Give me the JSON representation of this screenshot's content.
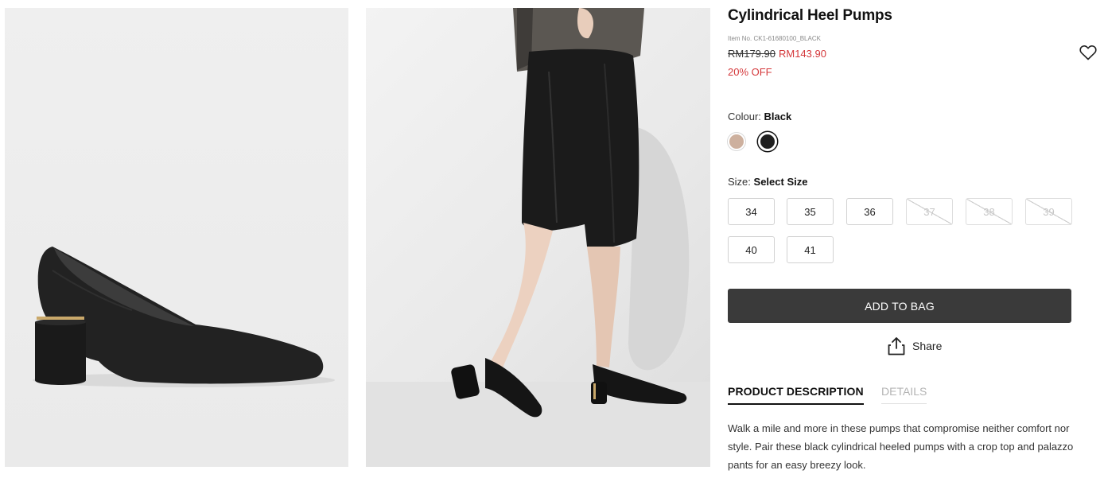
{
  "product": {
    "title": "Cylindrical Heel Pumps",
    "item_no": "Item No. CK1-61680100_BLACK",
    "price_old": "RM179.90",
    "price_new": "RM143.90",
    "discount": "20% OFF"
  },
  "colour": {
    "label": "Colour:",
    "selected": "Black",
    "swatches": [
      {
        "name": "beige",
        "color": "#cdb09e"
      },
      {
        "name": "black",
        "color": "#1f1f1f"
      }
    ]
  },
  "size": {
    "label": "Size:",
    "selected": "Select Size",
    "options": [
      {
        "label": "34",
        "available": true
      },
      {
        "label": "35",
        "available": true
      },
      {
        "label": "36",
        "available": true
      },
      {
        "label": "37",
        "available": false
      },
      {
        "label": "38",
        "available": false
      },
      {
        "label": "39",
        "available": false
      },
      {
        "label": "40",
        "available": true
      },
      {
        "label": "41",
        "available": true
      }
    ]
  },
  "actions": {
    "add_to_bag": "ADD TO BAG",
    "share": "Share"
  },
  "tabs": [
    {
      "label": "PRODUCT DESCRIPTION",
      "active": true
    },
    {
      "label": "DETAILS",
      "active": false
    }
  ],
  "description": "Walk a mile and more in these pumps that compromise neither comfort nor style. Pair these black cylindrical heeled pumps with a crop top and palazzo pants for an easy breezy look.",
  "icons": {
    "wishlist": "heart-icon",
    "share": "share-icon"
  },
  "colors": {
    "sale_red": "#d4383b",
    "button_dark": "#3a3a3a"
  }
}
